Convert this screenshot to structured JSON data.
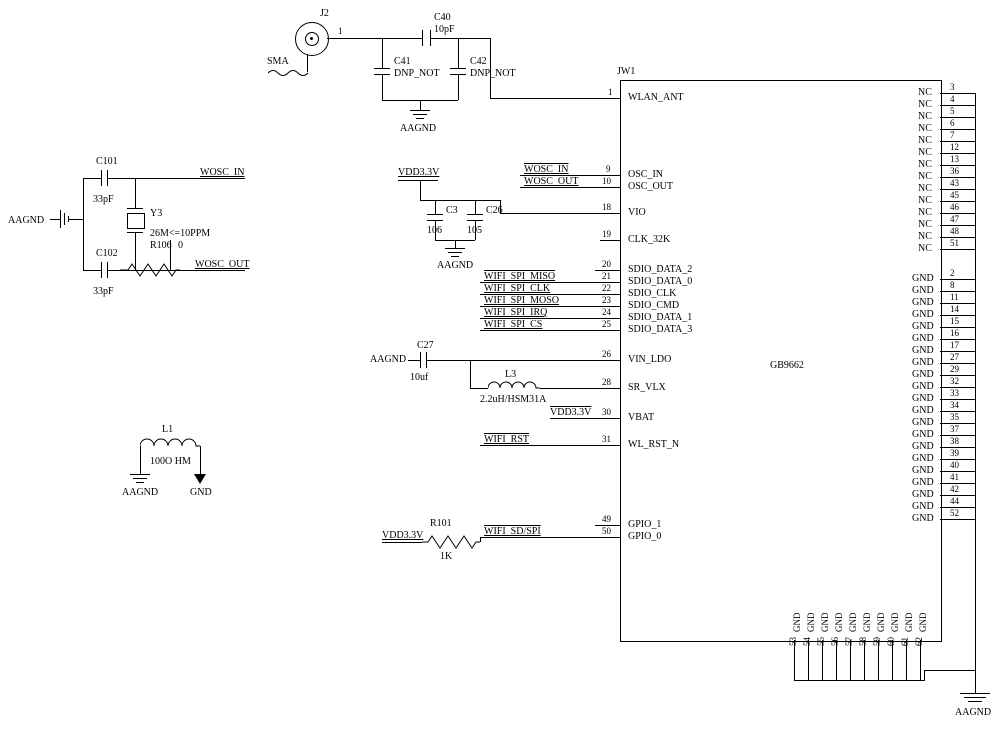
{
  "ic": {
    "ref": "JW1",
    "part": "GB9662",
    "left_pins": [
      {
        "num": "1",
        "name": "WLAN_ANT"
      },
      {
        "num": "9",
        "name": "OSC_IN",
        "net": "WOSC_IN"
      },
      {
        "num": "10",
        "name": "OSC_OUT",
        "net": "WOSC_OUT"
      },
      {
        "num": "18",
        "name": "VIO"
      },
      {
        "num": "19",
        "name": "CLK_32K"
      },
      {
        "num": "20",
        "name": "SDIO_DATA_2"
      },
      {
        "num": "21",
        "name": "SDIO_DATA_0",
        "net": "WIFI_SPI_MISO"
      },
      {
        "num": "22",
        "name": "SDIO_CLK",
        "net": "WIFI_SPI_CLK"
      },
      {
        "num": "23",
        "name": "SDIO_CMD",
        "net": "WIFI_SPI_MOSO"
      },
      {
        "num": "24",
        "name": "SDIO_DATA_1",
        "net": "WIFI_SPI_IRQ"
      },
      {
        "num": "25",
        "name": "SDIO_DATA_3",
        "net": "WIFI_SPI_CS"
      },
      {
        "num": "26",
        "name": "VIN_LDO"
      },
      {
        "num": "28",
        "name": "SR_VLX"
      },
      {
        "num": "30",
        "name": "VBAT",
        "net": "VDD3.3V"
      },
      {
        "num": "31",
        "name": "WL_RST_N",
        "net": "WIFI_RST"
      },
      {
        "num": "49",
        "name": "GPIO_1"
      },
      {
        "num": "50",
        "name": "GPIO_0",
        "net": "WIFI_SD/SPI"
      }
    ],
    "right_nc": [
      "3",
      "4",
      "5",
      "6",
      "7",
      "12",
      "13",
      "36",
      "43",
      "45",
      "46",
      "47",
      "48",
      "51"
    ],
    "right_gnd": [
      "2",
      "8",
      "11",
      "14",
      "15",
      "16",
      "17",
      "27",
      "29",
      "32",
      "33",
      "34",
      "35",
      "37",
      "38",
      "39",
      "40",
      "41",
      "42",
      "44",
      "52"
    ],
    "bottom_gnd": [
      "53",
      "54",
      "55",
      "56",
      "57",
      "58",
      "59",
      "60",
      "61",
      "62"
    ]
  },
  "connector": {
    "ref": "J2",
    "type": "SMA"
  },
  "caps": {
    "c40": {
      "ref": "C40",
      "val": "10pF"
    },
    "c41": {
      "ref": "C41",
      "val": "DNP_NOT"
    },
    "c42": {
      "ref": "C42",
      "val": "DNP_NOT"
    },
    "c101": {
      "ref": "C101",
      "val": "33pF"
    },
    "c102": {
      "ref": "C102",
      "val": "33pF"
    },
    "c3": {
      "ref": "C3",
      "val": "106"
    },
    "c26": {
      "ref": "C26",
      "val": "105"
    },
    "c27": {
      "ref": "C27",
      "val": "10uf"
    }
  },
  "inductors": {
    "l1": {
      "ref": "L1",
      "val": "100O HM"
    },
    "l3": {
      "ref": "L3",
      "val": "2.2uH/HSM31A"
    }
  },
  "resistors": {
    "r101": {
      "ref": "R101",
      "val": "1K"
    },
    "r106": {
      "ref": "R106",
      "val": "0"
    }
  },
  "crystal": {
    "ref": "Y3",
    "spec": "26M<=10PPM"
  },
  "nets": {
    "aagnd": "AAGND",
    "gnd": "GND",
    "vdd": "VDD3.3V",
    "nc": "NC",
    "wosc_in": "WOSC_IN",
    "wosc_out": "WOSC_OUT"
  }
}
